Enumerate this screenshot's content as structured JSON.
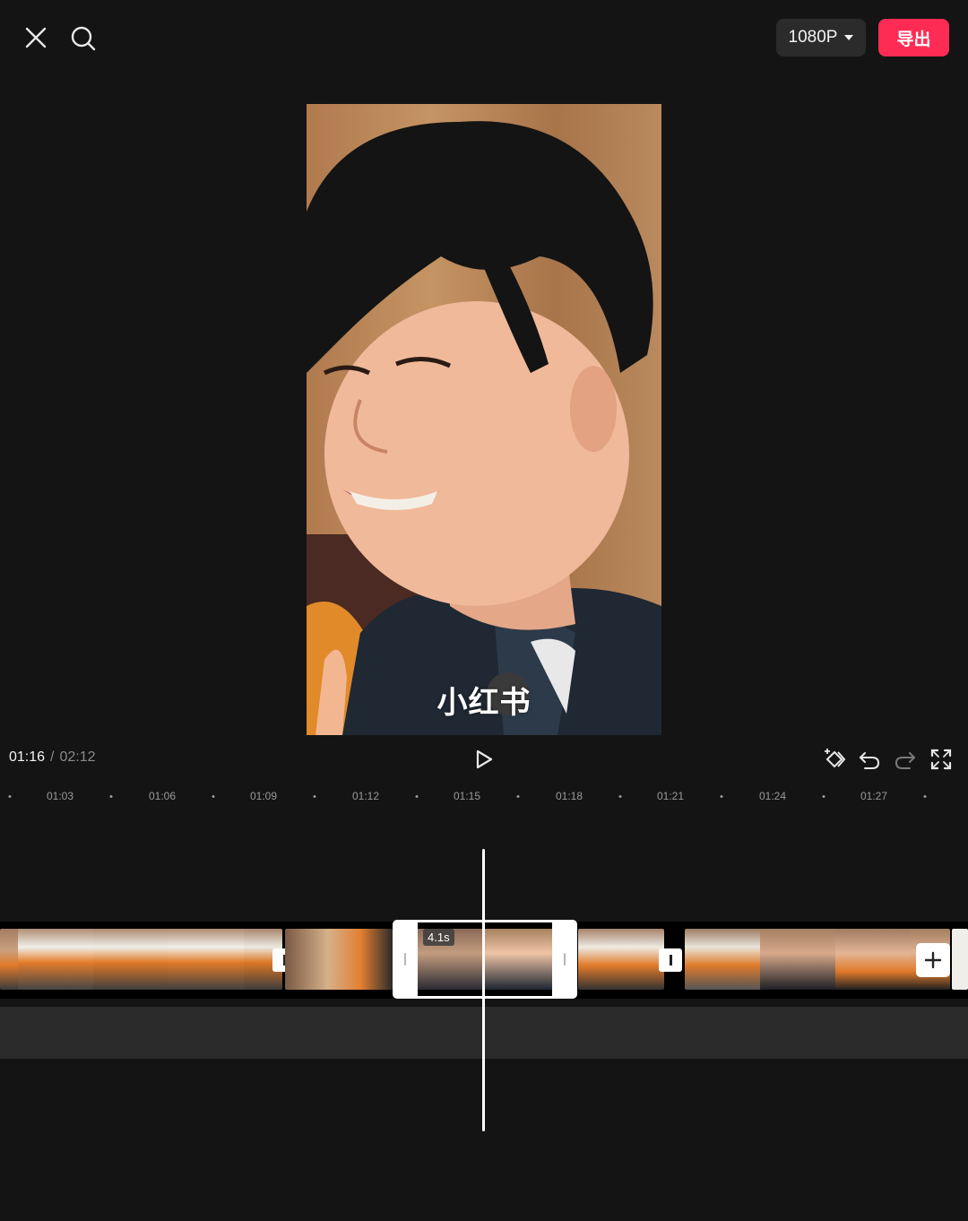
{
  "topbar": {
    "resolution_label": "1080P",
    "export_label": "导出"
  },
  "preview": {
    "watermark": "小红书"
  },
  "playback": {
    "current_time": "01:16",
    "separator": "/",
    "total_time": "02:12"
  },
  "ruler": {
    "labels": [
      "01:03",
      "01:06",
      "01:09",
      "01:12",
      "01:15",
      "01:18",
      "01:21",
      "01:24",
      "01:27"
    ]
  },
  "timeline": {
    "selected_clip_duration": "4.1s"
  },
  "colors": {
    "accent": "#fe2c55",
    "background": "#141414"
  }
}
